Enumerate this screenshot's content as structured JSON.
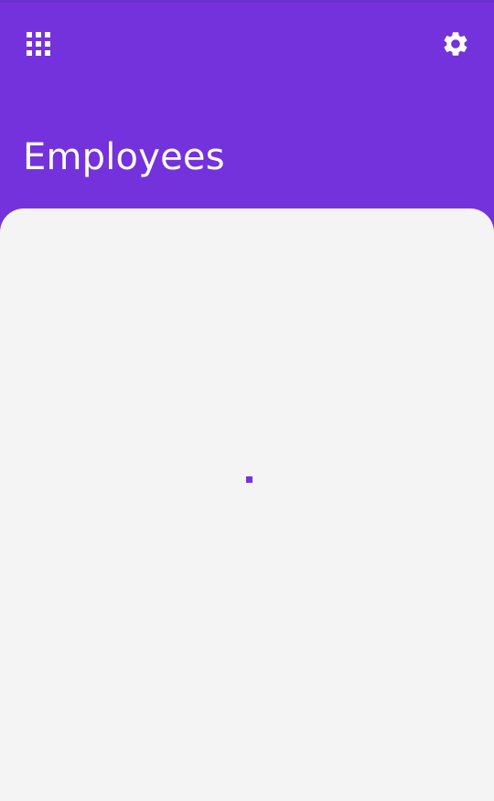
{
  "header": {
    "title": "Employees",
    "apps_icon": "apps-grid-icon",
    "settings_icon": "gear-icon"
  },
  "content": {
    "state": "loading",
    "spinner_icon": "loading-spinner-icon"
  },
  "colors": {
    "primary": "#7432dc",
    "background": "#f4f4f4",
    "on_primary": "#ffffff"
  }
}
